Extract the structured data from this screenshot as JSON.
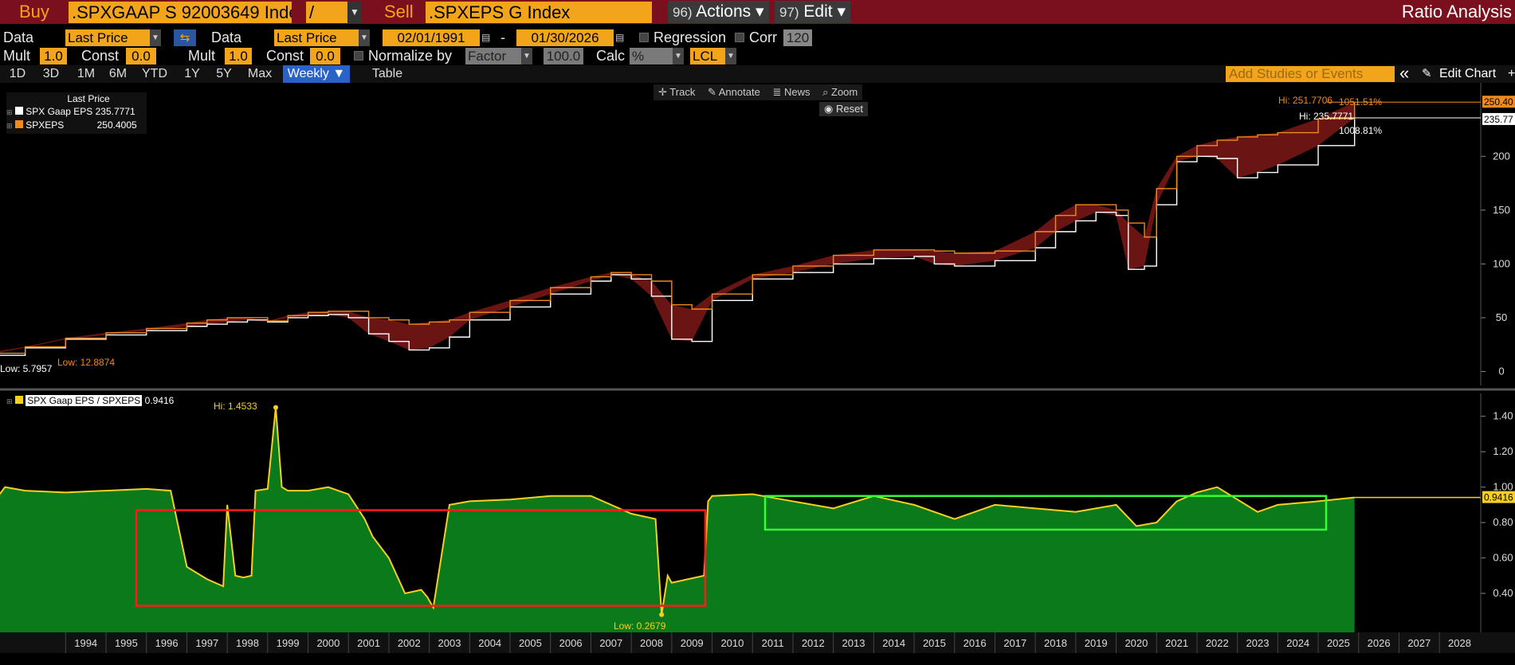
{
  "topbar": {
    "buy_label": "Buy",
    "buy_ticker": ".SPXGAAP S 92003649 Inde",
    "operator": "/",
    "sell_label": "Sell",
    "sell_ticker": ".SPXEPS G Index",
    "actions_num": "96)",
    "actions_label": "Actions ▾",
    "edit_num": "97)",
    "edit_label": "Edit ▾",
    "title": "Ratio Analysis"
  },
  "row1": {
    "data1_label": "Data",
    "data1_value": "Last Price",
    "swap_icon": "swap-arrows-icon",
    "data2_label": "Data",
    "data2_value": "Last Price",
    "start_date": "02/01/1991",
    "dash": "-",
    "end_date": "01/30/2026",
    "regression_label": "Regression",
    "corr_label": "Corr",
    "corr_value": "120"
  },
  "row2": {
    "mult1_label": "Mult",
    "mult1_value": "1.0",
    "const1_label": "Const",
    "const1_value": "0.0",
    "mult2_label": "Mult",
    "mult2_value": "1.0",
    "const2_label": "Const",
    "const2_value": "0.0",
    "normalize_label": "Normalize by",
    "normalize_value": "Factor",
    "normalize_num": "100.0",
    "calc_label": "Calc",
    "calc_value": "%",
    "currency_value": "LCL"
  },
  "tabs": [
    "1D",
    "3D",
    "1M",
    "6M",
    "YTD",
    "1Y",
    "5Y",
    "Max",
    "Weekly ▼",
    "Table"
  ],
  "active_tab": "Weekly ▼",
  "studies_placeholder": "Add Studies or Events",
  "collapse_label": "«",
  "edit_chart_label": "Edit Chart",
  "tools": {
    "track": "Track",
    "annotate": "Annotate",
    "news": "News",
    "zoom": "Zoom",
    "reset": "Reset"
  },
  "legend_top": {
    "header": "Last Price",
    "items": [
      {
        "name": "SPX Gaap EPS",
        "value": "235.7771",
        "color": "#ffffff"
      },
      {
        "name": "SPXEPS",
        "value": "250.4005",
        "color": "#f08a1c"
      }
    ]
  },
  "legend_bottom": {
    "name": "SPX Gaap EPS / SPXEPS",
    "value": "0.9416",
    "color": "#f5d020"
  },
  "annotations": {
    "top_low_white": "Low: 5.7957",
    "top_low_orange": "Low: 12.8874",
    "top_hi_orange": "Hi: 251.7706",
    "top_hi_orange_pct": "1051.51%",
    "top_hi_white": "Hi: 235.7771",
    "top_hi_white_pct": "1008.81%",
    "top_last_orange": "250.40",
    "top_last_white": "235.77",
    "bot_hi": "Hi: 1.4533",
    "bot_low": "Low: 0.2679",
    "bot_last": "0.9416"
  },
  "colors": {
    "top_bar": "#7a0f1d",
    "accent": "#f2a51a",
    "area_green": "#0a7a1a",
    "ratio_line": "#f5d020",
    "spread_fill": "#6b1414",
    "highlight_red": "#ff1a1a",
    "highlight_green": "#33ff33"
  },
  "chart_data": [
    {
      "type": "line",
      "title": "",
      "y_ticks": [
        "0",
        "50",
        "100",
        "150",
        "200"
      ],
      "ylim": [
        -10,
        255
      ],
      "series": [
        {
          "name": "SPX Gaap EPS",
          "color": "#ffffff",
          "x": [
            1991.1,
            1992,
            1993,
            1994,
            1995,
            1996,
            1997,
            1997.5,
            1998,
            1998.5,
            1999,
            1999.5,
            2000,
            2000.5,
            2001,
            2001.5,
            2002,
            2002.5,
            2003,
            2003.5,
            2004,
            2005,
            2006,
            2007,
            2007.5,
            2008,
            2008.5,
            2009,
            2009.5,
            2010,
            2011,
            2012,
            2013,
            2014,
            2015,
            2015.5,
            2016,
            2017,
            2018,
            2018.5,
            2019,
            2019.5,
            2020,
            2020.3,
            2020.7,
            2021,
            2021.5,
            2022,
            2022.5,
            2023,
            2023.5,
            2024,
            2025,
            2025.9
          ],
          "y": [
            5.8,
            15,
            22,
            30,
            34,
            38,
            42,
            44,
            46,
            48,
            46,
            50,
            52,
            53,
            50,
            35,
            28,
            20,
            22,
            32,
            48,
            60,
            72,
            84,
            90,
            86,
            70,
            30,
            28,
            66,
            86,
            92,
            100,
            105,
            107,
            100,
            98,
            103,
            115,
            130,
            140,
            148,
            145,
            95,
            98,
            155,
            195,
            200,
            198,
            180,
            185,
            192,
            210,
            235.8
          ]
        },
        {
          "name": "SPXEPS",
          "color": "#f08a1c",
          "x": [
            1991.1,
            1992,
            1993,
            1994,
            1995,
            1996,
            1997,
            1997.5,
            1998,
            1998.5,
            1999,
            1999.5,
            2000,
            2000.5,
            2001,
            2001.5,
            2002,
            2002.5,
            2003,
            2003.5,
            2004,
            2005,
            2006,
            2007,
            2007.5,
            2008,
            2008.5,
            2009,
            2009.5,
            2010,
            2011,
            2012,
            2013,
            2014,
            2015,
            2015.5,
            2016,
            2017,
            2018,
            2018.5,
            2019,
            2019.5,
            2020,
            2020.3,
            2020.7,
            2021,
            2021.5,
            2022,
            2022.5,
            2023,
            2023.5,
            2024,
            2025,
            2025.9
          ],
          "y": [
            12.9,
            17,
            23,
            31,
            36,
            40,
            45,
            48,
            50,
            50,
            47,
            52,
            55,
            56,
            56,
            50,
            48,
            44,
            46,
            48,
            55,
            66,
            78,
            88,
            92,
            90,
            84,
            62,
            58,
            72,
            90,
            98,
            108,
            113,
            113,
            112,
            110,
            112,
            130,
            145,
            155,
            155,
            150,
            138,
            125,
            170,
            200,
            210,
            215,
            218,
            220,
            222,
            235,
            250.4
          ]
        }
      ]
    },
    {
      "type": "area",
      "title": "",
      "y_ticks": [
        "0.40",
        "0.60",
        "0.80",
        "1.00",
        "1.20",
        "1.40"
      ],
      "ylim": [
        0.18,
        1.52
      ],
      "x_ticks": [
        "1994",
        "1995",
        "1996",
        "1997",
        "1998",
        "1999",
        "2000",
        "2001",
        "2002",
        "2003",
        "2004",
        "2005",
        "2006",
        "2007",
        "2008",
        "2009",
        "2010",
        "2011",
        "2012",
        "2013",
        "2014",
        "2015",
        "2016",
        "2017",
        "2018",
        "2019",
        "2020",
        "2021",
        "2022",
        "2023",
        "2024",
        "2025",
        "2026",
        "2027",
        "2028"
      ],
      "series": [
        {
          "name": "SPX Gaap EPS / SPXEPS",
          "color": "#f5d020",
          "x": [
            1991.1,
            1992,
            1992.5,
            1993,
            1994,
            1995,
            1996,
            1996.6,
            1997,
            1997.5,
            1997.9,
            1998.0,
            1998.2,
            1998.4,
            1998.6,
            1998.7,
            1999,
            1999.2,
            1999.35,
            1999.5,
            2000,
            2000.5,
            2001,
            2001.4,
            2001.6,
            2002,
            2002.4,
            2002.8,
            2002.95,
            2003.1,
            2003.5,
            2004,
            2005,
            2006,
            2006.5,
            2007,
            2007.5,
            2008,
            2008.6,
            2008.75,
            2008.9,
            2009,
            2009.4,
            2009.8,
            2009.9,
            2010,
            2011,
            2012,
            2013,
            2014,
            2015,
            2016,
            2017,
            2018,
            2019,
            2020,
            2020.5,
            2021,
            2021.5,
            2022,
            2022.5,
            2023,
            2023.5,
            2024,
            2025,
            2025.9
          ],
          "y": [
            0.8,
            0.85,
            1.0,
            0.98,
            0.97,
            0.98,
            0.99,
            0.98,
            0.55,
            0.48,
            0.44,
            0.9,
            0.5,
            0.49,
            0.5,
            0.98,
            0.99,
            1.45,
            1.0,
            0.98,
            0.98,
            1.0,
            0.96,
            0.82,
            0.72,
            0.6,
            0.4,
            0.42,
            0.38,
            0.32,
            0.9,
            0.92,
            0.93,
            0.95,
            0.95,
            0.95,
            0.9,
            0.85,
            0.82,
            0.28,
            0.5,
            0.46,
            0.48,
            0.5,
            0.92,
            0.95,
            0.96,
            0.92,
            0.88,
            0.95,
            0.9,
            0.82,
            0.9,
            0.88,
            0.86,
            0.9,
            0.78,
            0.8,
            0.92,
            0.97,
            1.0,
            0.93,
            0.86,
            0.9,
            0.92,
            0.9416
          ]
        }
      ]
    }
  ]
}
